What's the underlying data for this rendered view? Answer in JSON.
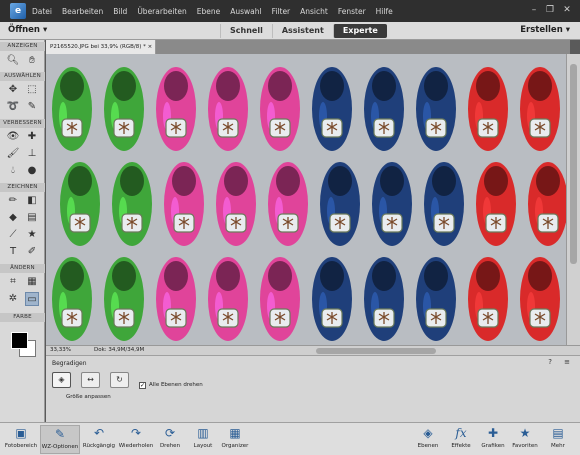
{
  "menu": {
    "logo": "e",
    "items": [
      "Datei",
      "Bearbeiten",
      "Bild",
      "Überarbeiten",
      "Ebene",
      "Auswahl",
      "Filter",
      "Ansicht",
      "Fenster",
      "Hilfe"
    ]
  },
  "modebar": {
    "open_label": "Öffnen",
    "tabs": [
      "Schnell",
      "Assistent",
      "Experte"
    ],
    "active_tab": "Experte",
    "create_label": "Erstellen"
  },
  "toolbox": {
    "sections": [
      "ANZEIGEN",
      "AUSWÄHLEN",
      "VERBESSERN",
      "ZEICHNEN",
      "ÄNDERN",
      "FARBE"
    ]
  },
  "document": {
    "tab_title": "P2165520.JPG bei 33,9% (RGB/8) *",
    "close_symbol": "×",
    "zoom": "33,33%",
    "doc_info": "Dok: 34,9M/34,9M"
  },
  "image": {
    "shoe_colors": {
      "green": "#3fa63a",
      "pink": "#e0449a",
      "navy": "#1f3f7a",
      "red": "#d92a2a"
    },
    "column_colors": [
      "green",
      "green",
      "pink",
      "pink",
      "pink",
      "navy",
      "navy",
      "navy",
      "red",
      "red"
    ]
  },
  "options": {
    "title": "Begradigen",
    "check_label": "Alle Ebenen drehen",
    "check_state": "✓",
    "sub_label": "Größe anpassen",
    "help_symbol": "?",
    "menu_symbol": "≡"
  },
  "bottombar": {
    "left": [
      {
        "label": "Fotobereich",
        "icon": "photo-bin-icon"
      },
      {
        "label": "WZ-Optionen",
        "icon": "tool-options-icon"
      },
      {
        "label": "Rückgängig",
        "icon": "undo-icon"
      },
      {
        "label": "Wiederholen",
        "icon": "redo-icon"
      },
      {
        "label": "Drehen",
        "icon": "rotate-icon"
      },
      {
        "label": "Layout",
        "icon": "layout-icon"
      },
      {
        "label": "Organizer",
        "icon": "organizer-icon"
      }
    ],
    "right": [
      {
        "label": "Ebenen",
        "icon": "layers-icon"
      },
      {
        "label": "Effekte",
        "icon": "effects-icon"
      },
      {
        "label": "Grafiken",
        "icon": "graphics-icon"
      },
      {
        "label": "Favoriten",
        "icon": "favorites-icon"
      },
      {
        "label": "Mehr",
        "icon": "more-icon"
      }
    ]
  }
}
